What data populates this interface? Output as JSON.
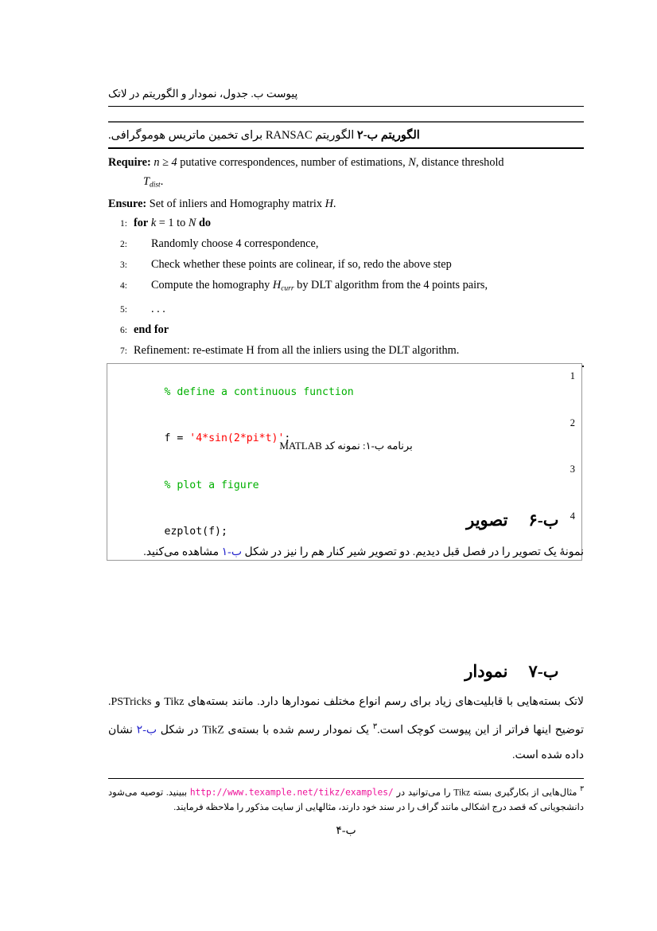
{
  "page": {
    "running_header": "پیوست ب. جدول، نمودار و الگوریتم در لاتک",
    "page_number": "ب-۴"
  },
  "algorithm": {
    "caption_bold": "الگوریتم ب-۲",
    "caption_rest_a": " الگوریتم ",
    "caption_latin": "RANSAC",
    "caption_rest_b": " برای تخمین ماتریس هوموگرافی.",
    "require_label": "Require:",
    "require_text_1": "n ≥ 4",
    "require_text_2": "putative correspondences, number of estimations,",
    "require_var_N": "N",
    "require_text_3": ", distance threshold",
    "require_cont_var": "T",
    "require_cont_sub": "dist",
    "require_cont_dot": ".",
    "ensure_label": "Ensure:",
    "ensure_text": "Set of inliers and Homography matrix",
    "ensure_var": "H",
    "ensure_dot": ".",
    "lines": [
      {
        "no": "1:",
        "kw_a": "for",
        "var_a": "k",
        "mid": "= 1 to",
        "var_b": "N",
        "kw_b": "do",
        "indent": false
      },
      {
        "no": "2:",
        "text": "Randomly choose 4 correspondence,",
        "indent": true
      },
      {
        "no": "3:",
        "text": "Check whether these points are colinear, if so, redo the above step",
        "indent": true
      },
      {
        "no": "4:",
        "text_a": "Compute the homography",
        "var": "H",
        "sub": "curr",
        "text_b": "by DLT algorithm from the 4 points pairs,",
        "indent": true
      },
      {
        "no": "5:",
        "text": ". . .",
        "indent": true
      },
      {
        "no": "6:",
        "bold_text": "end for",
        "indent": false
      },
      {
        "no": "7:",
        "text": "Refinement: re-estimate H from all the inliers using the DLT algorithm.",
        "indent": false
      }
    ]
  },
  "listing": {
    "rows": [
      {
        "no": "1",
        "kind": "comment",
        "text": "% define a continuous function"
      },
      {
        "no": "2",
        "kind": "mixed",
        "pre": "f = ",
        "str": "'4*sin(2*pi*t)'",
        "post": ";"
      },
      {
        "no": "3",
        "kind": "comment",
        "text": "% plot a figure"
      },
      {
        "no": "4",
        "kind": "plain",
        "text": "ezplot(f);"
      }
    ],
    "caption_pre": "برنامه ب-۱: نمونه کد ",
    "caption_latin": "MATLAB"
  },
  "sections": [
    {
      "number": "ب-۶",
      "title": "تصویر",
      "paragraph_a": "نمونهٔ یک تصویر را در فصل قبل دیدیم. دو تصویر شیر کنار هم را نیز در شکل ",
      "paragraph_link": "ب-۱",
      "paragraph_b": " مشاهده می‌کنید."
    },
    {
      "number": "ب-۷",
      "title": "نمودار",
      "p1_a": "لاتک بسته‌هایی با قابلیت‌های زیاد برای رسم انواع مختلف نمودارها دارد. مانند بسته‌های ",
      "p1_latin_1": "Tikz",
      "p1_mid": " و ",
      "p1_latin_2": "PSTricks",
      "p1_end": ".",
      "p2_a": "توضیح اینها فراتر از این پیوست کوچک است.",
      "p2_footnote_mark": "۳",
      "p2_b": " یک نمودار رسم شده با بسته‌ی ",
      "p2_latin": "TikZ",
      "p2_c": " در شکل ",
      "p2_link": "ب-۲",
      "p2_d": " نشان داده شده است."
    }
  ],
  "footnote": {
    "mark": "۳",
    "text_a": " مثال‌هایی از بکارگیری بسته ",
    "latin_1": "Tikz",
    "text_b": " را می‌توانید در ",
    "url": "http://www.texample.net/tikz/examples/",
    "text_c": " ببینید. توصیه می‌شود دانشجویانی که قصد درج اشکالی مانند گراف را در سند خود دارند، مثالهایی از سایت مذکور را ملاحظه فرمایند."
  },
  "colors": {
    "comment_green": "#00b000",
    "string_red": "#ff0000",
    "url_magenta": "#ee1199",
    "ref_link_blue": "#2222cc"
  }
}
